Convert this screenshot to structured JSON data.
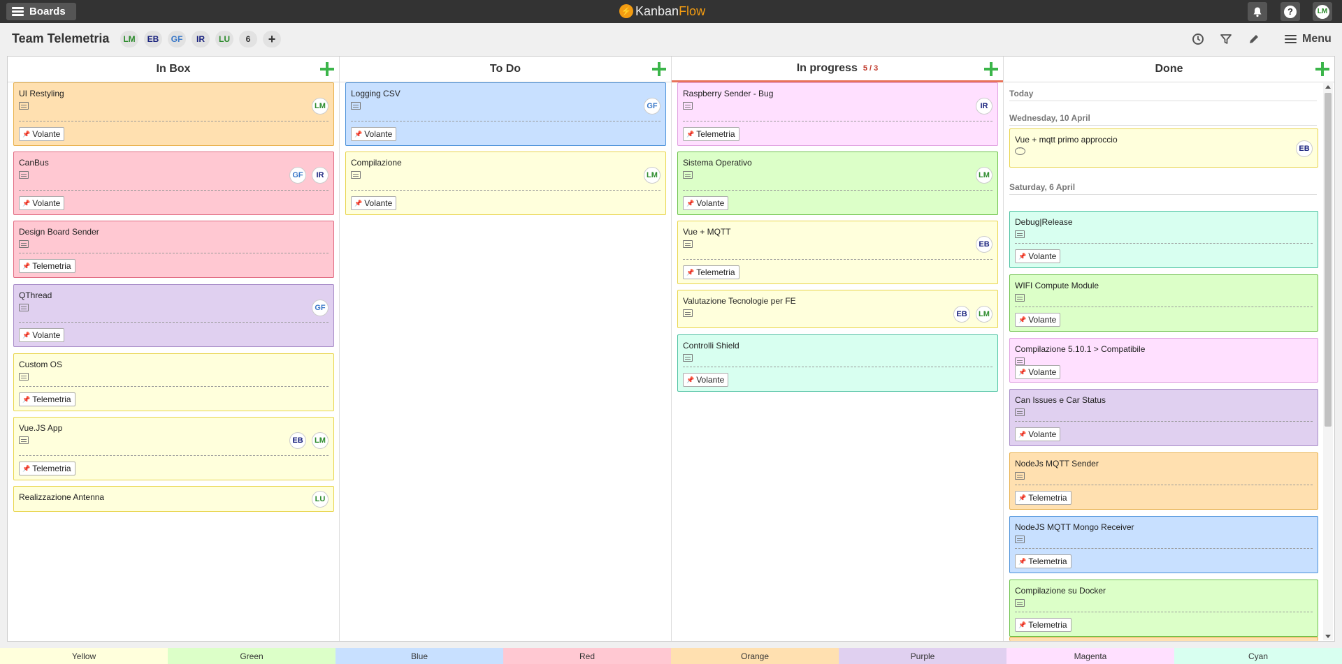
{
  "topbar": {
    "boards_label": "Boards",
    "logo_part1": "Kanban",
    "logo_part2": "Flow",
    "help_glyph": "?",
    "user_initials": "LM"
  },
  "header": {
    "board_title": "Team Telemetria",
    "members": [
      {
        "initials": "LM",
        "color": "#2a8a2a"
      },
      {
        "initials": "EB",
        "color": "#1a237e"
      },
      {
        "initials": "GF",
        "color": "#3a78c8"
      },
      {
        "initials": "IR",
        "color": "#1a237e"
      },
      {
        "initials": "LU",
        "color": "#2a8a2a"
      }
    ],
    "member_count": "6",
    "add_glyph": "+",
    "menu_label": "Menu"
  },
  "columns": {
    "inbox": {
      "title": "In Box"
    },
    "todo": {
      "title": "To Do"
    },
    "inprogress": {
      "title": "In progress",
      "wip": "5 / 3"
    },
    "done": {
      "title": "Done"
    }
  },
  "cards": {
    "inbox": [
      {
        "title": "UI Restyling",
        "tag": "Volante",
        "assignees": [
          "LM"
        ]
      },
      {
        "title": "CanBus",
        "tag": "Volante",
        "assignees": [
          "GF",
          "IR"
        ]
      },
      {
        "title": "Design Board Sender",
        "tag": "Telemetria",
        "assignees": []
      },
      {
        "title": "QThread",
        "tag": "Volante",
        "assignees": [
          "GF"
        ]
      },
      {
        "title": "Custom OS",
        "tag": "Telemetria",
        "assignees": []
      },
      {
        "title": "Vue.JS App",
        "tag": "Telemetria",
        "assignees": [
          "EB",
          "LM"
        ]
      },
      {
        "title": "Realizzazione Antenna",
        "tag": "",
        "assignees": [
          "LU"
        ]
      }
    ],
    "todo": [
      {
        "title": "Logging CSV",
        "tag": "Volante",
        "assignees": [
          "GF"
        ]
      },
      {
        "title": "Compilazione",
        "tag": "Volante",
        "assignees": [
          "LM"
        ]
      }
    ],
    "inprogress": [
      {
        "title": "Raspberry Sender - Bug",
        "tag": "Telemetria",
        "assignees": [
          "IR"
        ]
      },
      {
        "title": "Sistema Operativo",
        "tag": "Volante",
        "assignees": [
          "LM"
        ]
      },
      {
        "title": "Vue + MQTT",
        "tag": "Telemetria",
        "assignees": [
          "EB"
        ]
      },
      {
        "title": "Valutazione Tecnologie per FE",
        "tag": "",
        "assignees": [
          "EB",
          "LM"
        ]
      },
      {
        "title": "Controlli Shield",
        "tag": "Volante",
        "assignees": []
      }
    ],
    "done": [
      {
        "title": "Vue + mqtt primo approccio",
        "tag": "",
        "assignees": [
          "EB"
        ]
      },
      {
        "title": "Debug|Release",
        "tag": "Volante",
        "assignees": []
      },
      {
        "title": "WIFI Compute Module",
        "tag": "Volante",
        "assignees": []
      },
      {
        "title": "Compilazione 5.10.1 > Compatibile",
        "tag": "Volante",
        "assignees": []
      },
      {
        "title": "Can Issues e Car Status",
        "tag": "Volante",
        "assignees": []
      },
      {
        "title": "NodeJs MQTT Sender",
        "tag": "Telemetria",
        "assignees": []
      },
      {
        "title": "NodeJS MQTT Mongo Receiver",
        "tag": "Telemetria",
        "assignees": []
      },
      {
        "title": "Compilazione su Docker",
        "tag": "Telemetria",
        "assignees": []
      }
    ]
  },
  "done_sections": {
    "today": "Today",
    "wed": "Wednesday, 10 April",
    "sat": "Saturday, 6 April"
  },
  "legend": [
    "Yellow",
    "Green",
    "Blue",
    "Red",
    "Orange",
    "Purple",
    "Magenta",
    "Cyan"
  ],
  "colors": {
    "yellow": "#ffffdc",
    "green": "#dcffc8",
    "blue": "#c8e0ff",
    "red": "#ffc8d2",
    "orange": "#ffe0b0",
    "purple": "#e0d0f0",
    "magenta": "#ffe0ff",
    "cyan": "#d8fff0"
  }
}
